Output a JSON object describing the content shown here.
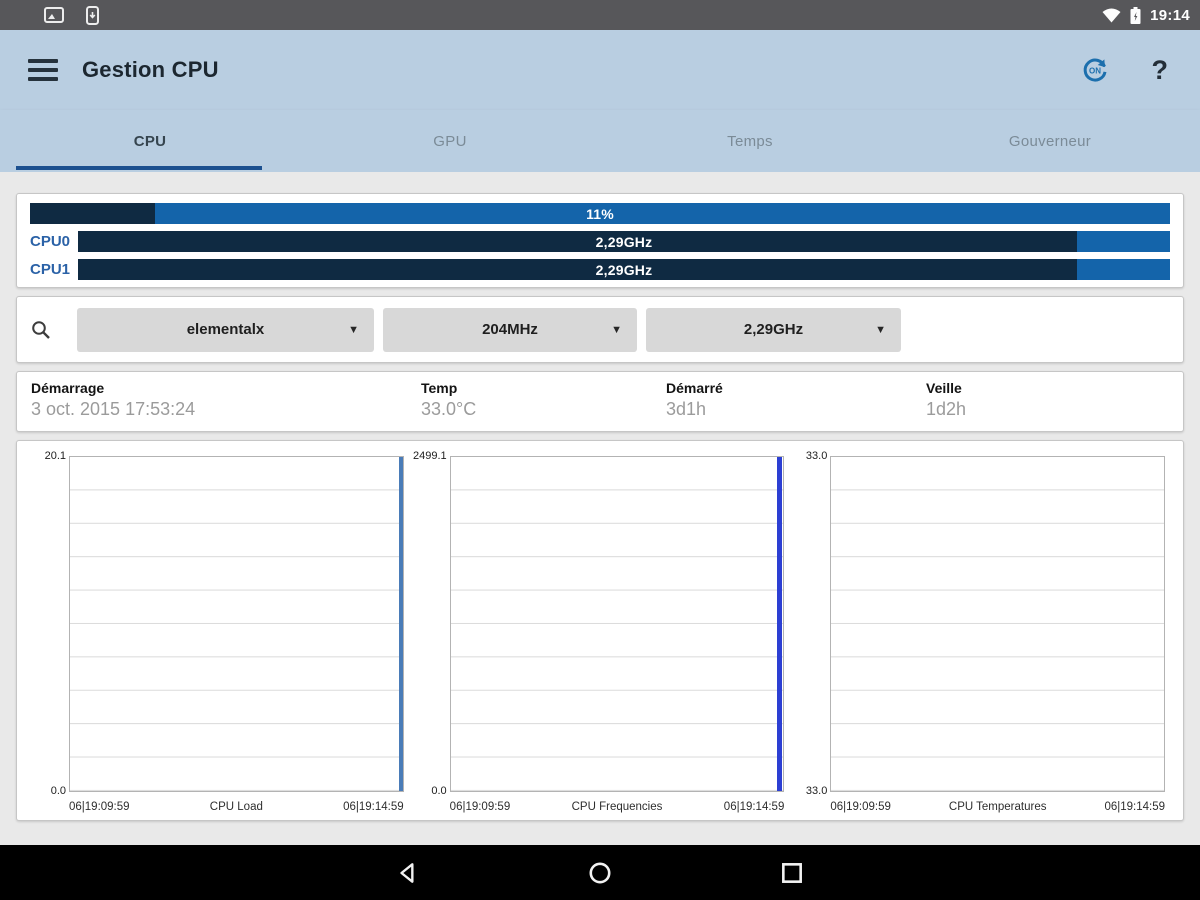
{
  "colors": {
    "bar_fill_dark": "#0f2a42",
    "bar_fill_light": "#1464aa",
    "load_line": "#4a7cb8",
    "freq_line": "#2c3fd3",
    "app_bar_bg": "#b9cee1",
    "tab_underline": "#1c508f"
  },
  "status_bar": {
    "time": "19:14"
  },
  "app_bar": {
    "title": "Gestion CPU",
    "boot_icon_label": "ON",
    "help_label": "?"
  },
  "tabs": [
    {
      "label": "CPU",
      "active": true
    },
    {
      "label": "GPU",
      "active": false
    },
    {
      "label": "Temps",
      "active": false
    },
    {
      "label": "Gouverneur",
      "active": false
    }
  ],
  "usage_card": {
    "total": {
      "label": "11%",
      "percent": 11,
      "fill_width": "11%"
    },
    "cores": [
      {
        "name": "CPU0",
        "value": "2,29GHz",
        "fill_width": "91.5%"
      },
      {
        "name": "CPU1",
        "value": "2,29GHz",
        "fill_width": "91.5%"
      }
    ]
  },
  "governor_card": {
    "governor": "elementalx",
    "min_freq": "204MHz",
    "max_freq": "2,29GHz",
    "caret": "▼"
  },
  "info_card": [
    {
      "label": "Démarrage",
      "value": "3 oct. 2015 17:53:24"
    },
    {
      "label": "Temp",
      "value": "33.0°C"
    },
    {
      "label": "Démarré",
      "value": "3d1h"
    },
    {
      "label": "Veille",
      "value": "1d2h"
    }
  ],
  "chart_data": [
    {
      "type": "line",
      "title": "CPU Load",
      "x_start": "06|19:09:59",
      "x_end": "06|19:14:59",
      "ylim": [
        0.0,
        20.1
      ],
      "y_top_label": "20.1",
      "y_bottom_label": "0.0",
      "grid": true,
      "line_color": "#4a7cb8",
      "series": [
        {
          "name": "CPU Load",
          "points": [
            {
              "x": "06|19:14:59",
              "y_min": 0.0,
              "y_max": 20.1
            }
          ]
        }
      ]
    },
    {
      "type": "line",
      "title": "CPU Frequencies",
      "x_start": "06|19:09:59",
      "x_end": "06|19:14:59",
      "ylim": [
        0.0,
        2499.1
      ],
      "y_top_label": "2499.1",
      "y_bottom_label": "0.0",
      "grid": true,
      "line_color": "#2c3fd3",
      "series": [
        {
          "name": "CPU Frequencies",
          "points": [
            {
              "x": "06|19:14:59",
              "y_min": 0.0,
              "y_max": 2499.1
            }
          ]
        }
      ]
    },
    {
      "type": "line",
      "title": "CPU Temperatures",
      "x_start": "06|19:09:59",
      "x_end": "06|19:14:59",
      "ylim": [
        33.0,
        33.0
      ],
      "y_top_label": "33.0",
      "y_bottom_label": "33.0",
      "grid": true,
      "line_color": null,
      "series": [
        {
          "name": "CPU Temperatures",
          "points": [
            {
              "x": "06|19:09:59",
              "y": 33.0
            },
            {
              "x": "06|19:14:59",
              "y": 33.0
            }
          ]
        }
      ]
    }
  ]
}
